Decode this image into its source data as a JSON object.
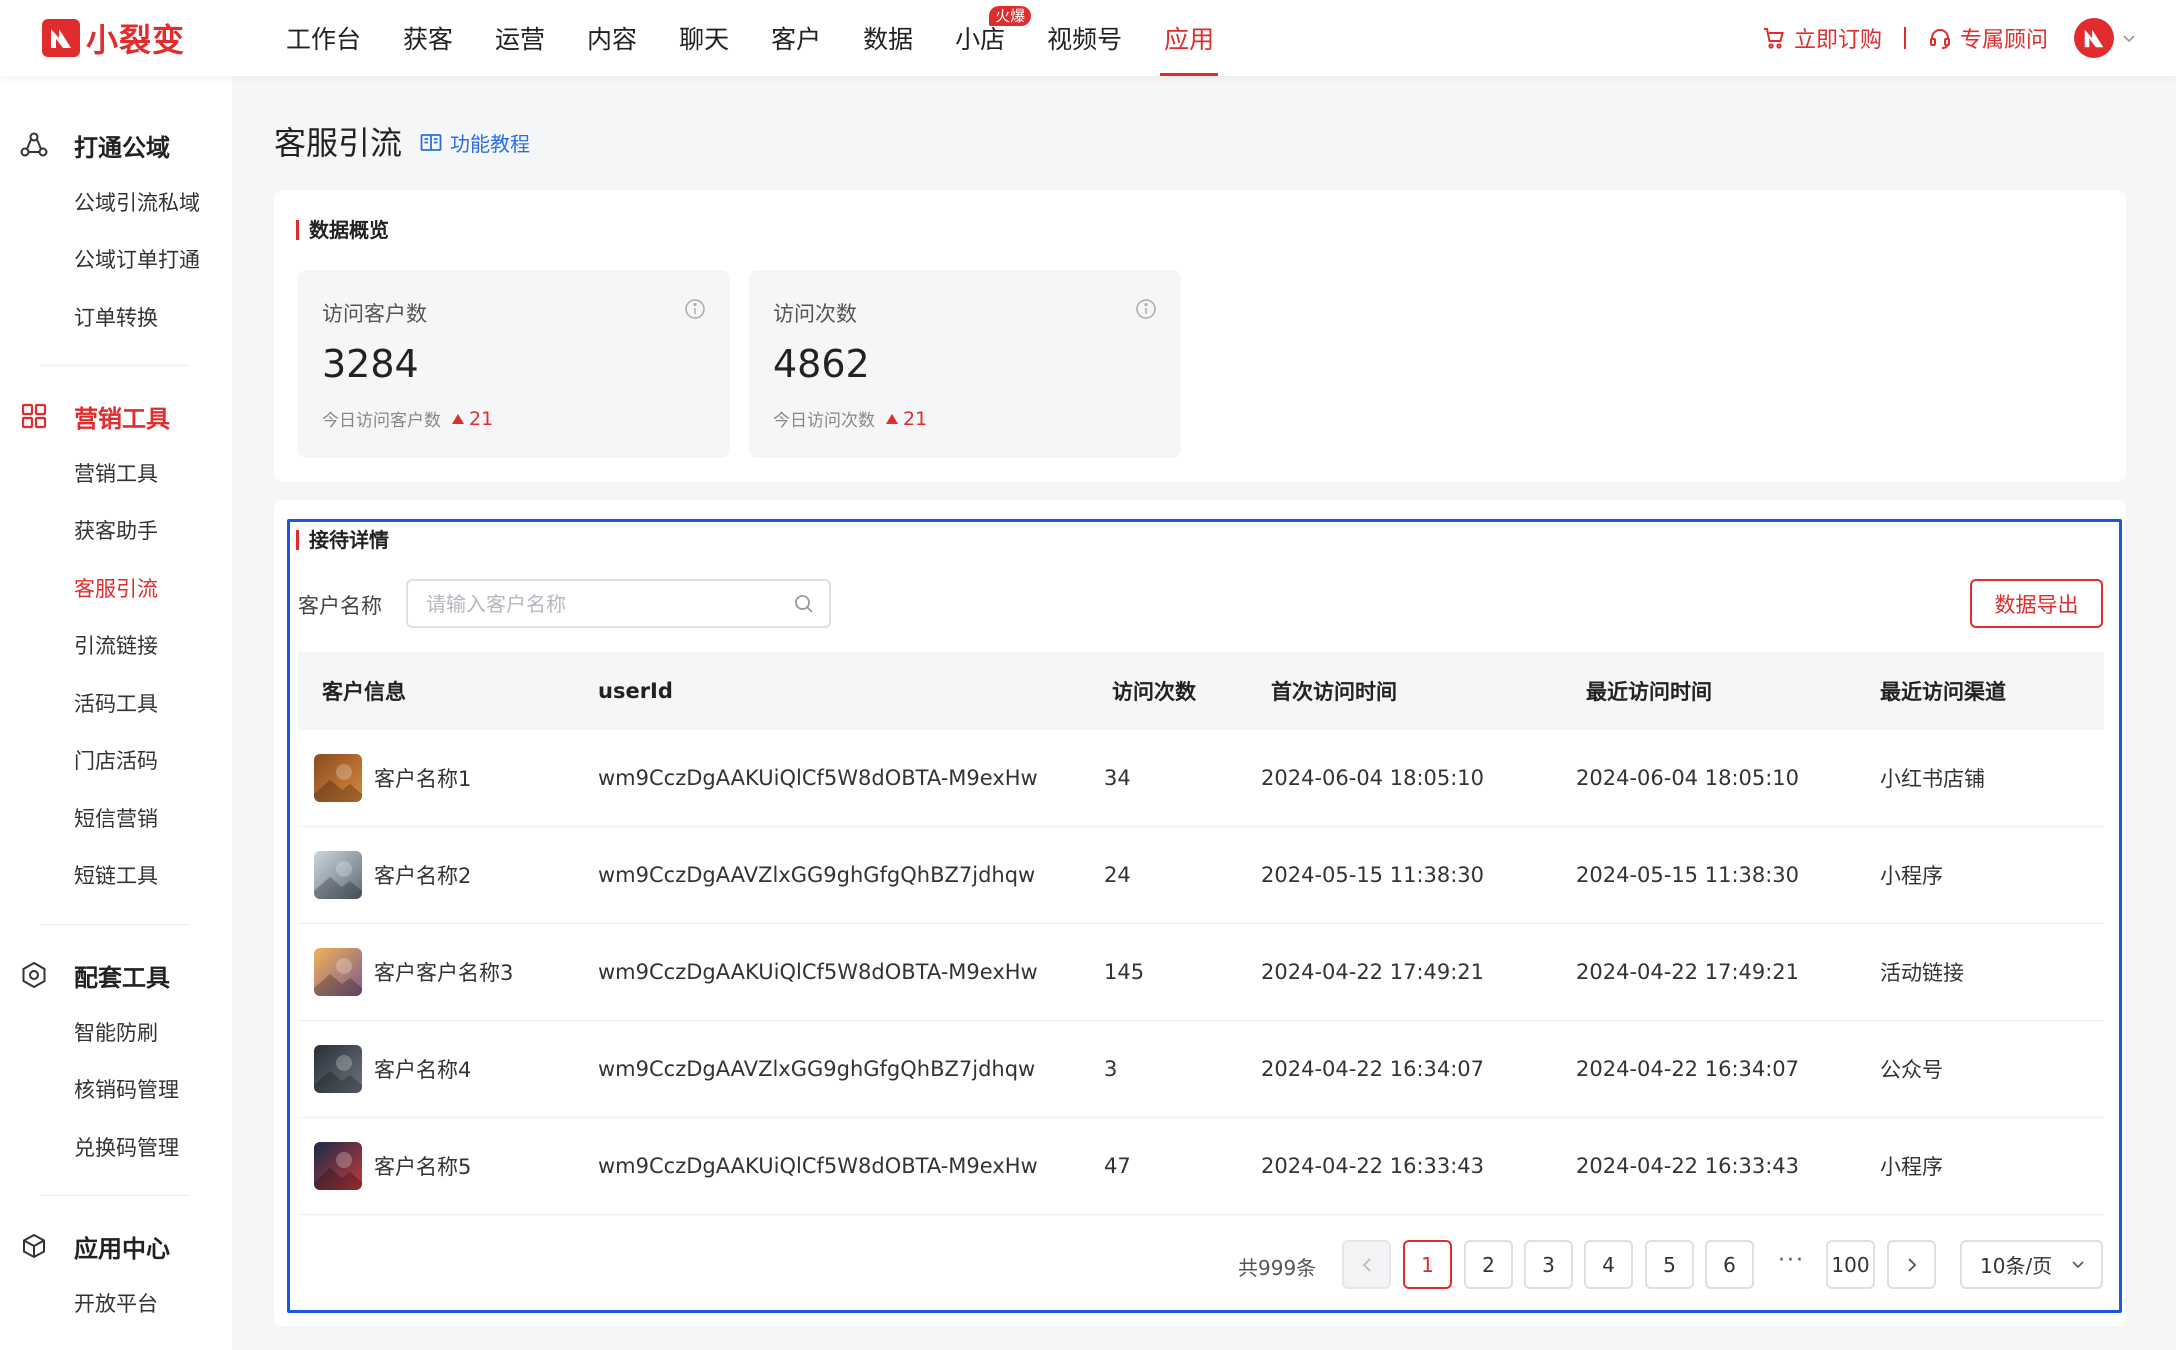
{
  "brand": {
    "name": "小裂变",
    "color": "#e02c2c"
  },
  "nav": {
    "items": [
      {
        "label": "工作台"
      },
      {
        "label": "获客"
      },
      {
        "label": "运营"
      },
      {
        "label": "内容"
      },
      {
        "label": "聊天"
      },
      {
        "label": "客户"
      },
      {
        "label": "数据"
      },
      {
        "label": "小店",
        "badge": "火爆"
      },
      {
        "label": "视频号"
      },
      {
        "label": "应用",
        "active": true
      }
    ],
    "order_label": "立即订购",
    "advisor_label": "专属顾问"
  },
  "sidebar": {
    "groups": [
      {
        "title": "打通公域",
        "icon": "link-network-icon",
        "items": [
          "公域引流私域",
          "公域订单打通",
          "订单转换"
        ]
      },
      {
        "title": "营销工具",
        "icon": "grid-icon",
        "active": true,
        "items": [
          "营销工具",
          "获客助手",
          "客服引流",
          "引流链接",
          "活码工具",
          "门店活码",
          "短信营销",
          "短链工具"
        ]
      },
      {
        "title": "配套工具",
        "icon": "hexagon-icon",
        "items": [
          "智能防刷",
          "核销码管理",
          "兑换码管理"
        ]
      },
      {
        "title": "应用中心",
        "icon": "cube-icon",
        "items": [
          "开放平台"
        ]
      }
    ],
    "active_item": "客服引流"
  },
  "page": {
    "title": "客服引流",
    "tutorial_label": "功能教程"
  },
  "overview": {
    "title": "数据概览",
    "cards": [
      {
        "label": "访问客户数",
        "value": "3284",
        "sub_label": "今日访问客户数",
        "delta": "21"
      },
      {
        "label": "访问次数",
        "value": "4862",
        "sub_label": "今日访问次数",
        "delta": "21"
      }
    ]
  },
  "details": {
    "title": "接待详情",
    "filter_label": "客户名称",
    "search_placeholder": "请输入客户名称",
    "export_label": "数据导出",
    "columns": [
      "客户信息",
      "userId",
      "访问次数",
      "首次访问时间",
      "最近访问时间",
      "最近访问渠道"
    ],
    "rows": [
      {
        "name": "客户名称1",
        "user_id": "wm9CczDgAAKUiQlCf5W8dOBTA-M9exHw",
        "visits": "34",
        "first": "2024-06-04 18:05:10",
        "last": "2024-06-04 18:05:10",
        "channel": "小红书店铺",
        "avatar_colors": [
          "#8a4a22",
          "#d98a3a"
        ]
      },
      {
        "name": "客户名称2",
        "user_id": "wm9CczDgAAVZlxGG9ghGfgQhBZ7jdhqw",
        "visits": "24",
        "first": "2024-05-15 11:38:30",
        "last": "2024-05-15 11:38:30",
        "channel": "小程序",
        "avatar_colors": [
          "#cfd6dc",
          "#5b6a78"
        ]
      },
      {
        "name": "客户客户名称3",
        "user_id": "wm9CczDgAAKUiQlCf5W8dOBTA-M9exHw",
        "visits": "145",
        "first": "2024-04-22 17:49:21",
        "last": "2024-04-22 17:49:21",
        "channel": "活动链接",
        "avatar_colors": [
          "#f0b25a",
          "#7d5a8a"
        ]
      },
      {
        "name": "客户名称4",
        "user_id": "wm9CczDgAAVZlxGG9ghGfgQhBZ7jdhqw",
        "visits": "3",
        "first": "2024-04-22 16:34:07",
        "last": "2024-04-22 16:34:07",
        "channel": "公众号",
        "avatar_colors": [
          "#2a2f36",
          "#6c7580"
        ]
      },
      {
        "name": "客户名称5",
        "user_id": "wm9CczDgAAKUiQlCf5W8dOBTA-M9exHw",
        "visits": "47",
        "first": "2024-04-22 16:33:43",
        "last": "2024-04-22 16:33:43",
        "channel": "小程序",
        "avatar_colors": [
          "#1c2a4a",
          "#c23a3a"
        ]
      }
    ]
  },
  "pagination": {
    "total": "共999条",
    "pages": [
      "1",
      "2",
      "3",
      "4",
      "5",
      "6"
    ],
    "ellipsis": "···",
    "last_page": "100",
    "current": "1",
    "page_size": "10条/页"
  }
}
